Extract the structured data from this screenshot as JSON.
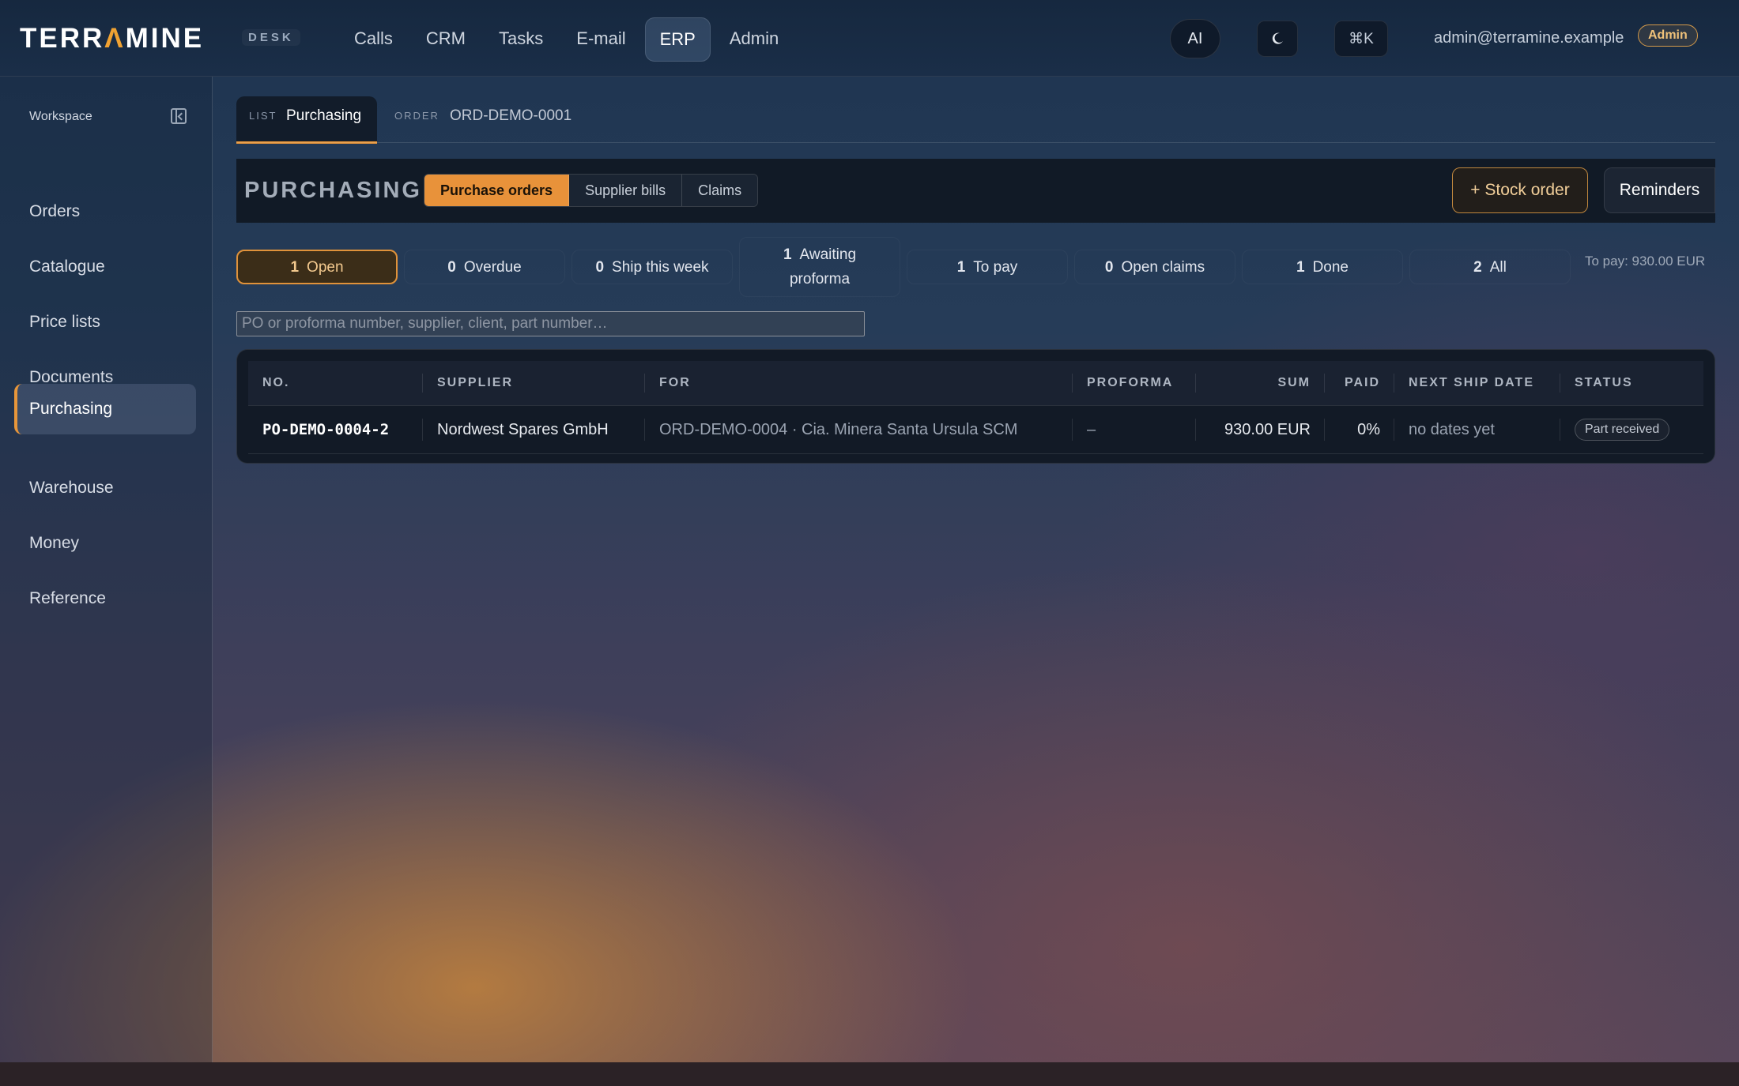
{
  "topbar": {
    "logo_pre": "TERR",
    "logo_accent": "Λ",
    "logo_post": "MINE",
    "desk": "DESK",
    "nav": [
      {
        "label": "Calls",
        "active": false
      },
      {
        "label": "CRM",
        "active": false
      },
      {
        "label": "Tasks",
        "active": false
      },
      {
        "label": "E-mail",
        "active": false
      },
      {
        "label": "ERP",
        "active": true
      },
      {
        "label": "Admin",
        "active": false
      }
    ],
    "ai_label": "AI",
    "theme_icon": "moon-icon",
    "cmdk_label": "⌘K",
    "user_email": "admin@terramine.example",
    "role": "Admin"
  },
  "sidebar": {
    "workspace_label": "Workspace",
    "items": [
      {
        "label": "Orders",
        "active": false
      },
      {
        "label": "Catalogue",
        "active": false
      },
      {
        "label": "Price lists",
        "active": false
      },
      {
        "label": "Documents",
        "active": false
      },
      {
        "label": "Purchasing",
        "active": true
      },
      {
        "label": "Warehouse",
        "active": false
      },
      {
        "label": "Money",
        "active": false
      },
      {
        "label": "Reference",
        "active": false
      }
    ]
  },
  "tabs": {
    "list_kicker": "LIST",
    "list_title": "Purchasing",
    "order_kicker": "ORDER",
    "order_title": "ORD-DEMO-0001"
  },
  "section": {
    "title": "PURCHASING",
    "segments": [
      "Purchase orders",
      "Supplier bills",
      "Claims"
    ],
    "active_segment": "Purchase orders",
    "stock_order": "+ Stock order",
    "reminders": "Reminders"
  },
  "filters": [
    {
      "count": "1",
      "label": "Open",
      "active": true
    },
    {
      "count": "0",
      "label": "Overdue",
      "active": false
    },
    {
      "count": "0",
      "label": "Ship this week",
      "active": false
    },
    {
      "count": "1",
      "label": "Awaiting",
      "label2": "proforma",
      "active": false
    },
    {
      "count": "1",
      "label": "To pay",
      "active": false
    },
    {
      "count": "0",
      "label": "Open claims",
      "active": false
    },
    {
      "count": "1",
      "label": "Done",
      "active": false
    },
    {
      "count": "2",
      "label": "All",
      "active": false
    }
  ],
  "to_pay": "To pay: 930.00 EUR",
  "search": {
    "placeholder": "PO or proforma number, supplier, client, part number…",
    "value": ""
  },
  "table": {
    "columns": [
      "NO.",
      "SUPPLIER",
      "FOR",
      "PROFORMA",
      "SUM",
      "PAID",
      "NEXT SHIP DATE",
      "STATUS"
    ],
    "rows": [
      {
        "no": "PO-DEMO-0004-2",
        "supplier": "Nordwest Spares GmbH",
        "for": "ORD-DEMO-0004 · Cia. Minera Santa Ursula SCM",
        "proforma": "–",
        "sum": "930.00 EUR",
        "paid": "0%",
        "next_ship": "no dates yet",
        "status": "Part received"
      }
    ]
  },
  "colors": {
    "accent": "#e8923a",
    "topbar": "#16283f",
    "panel": "#121a26"
  }
}
